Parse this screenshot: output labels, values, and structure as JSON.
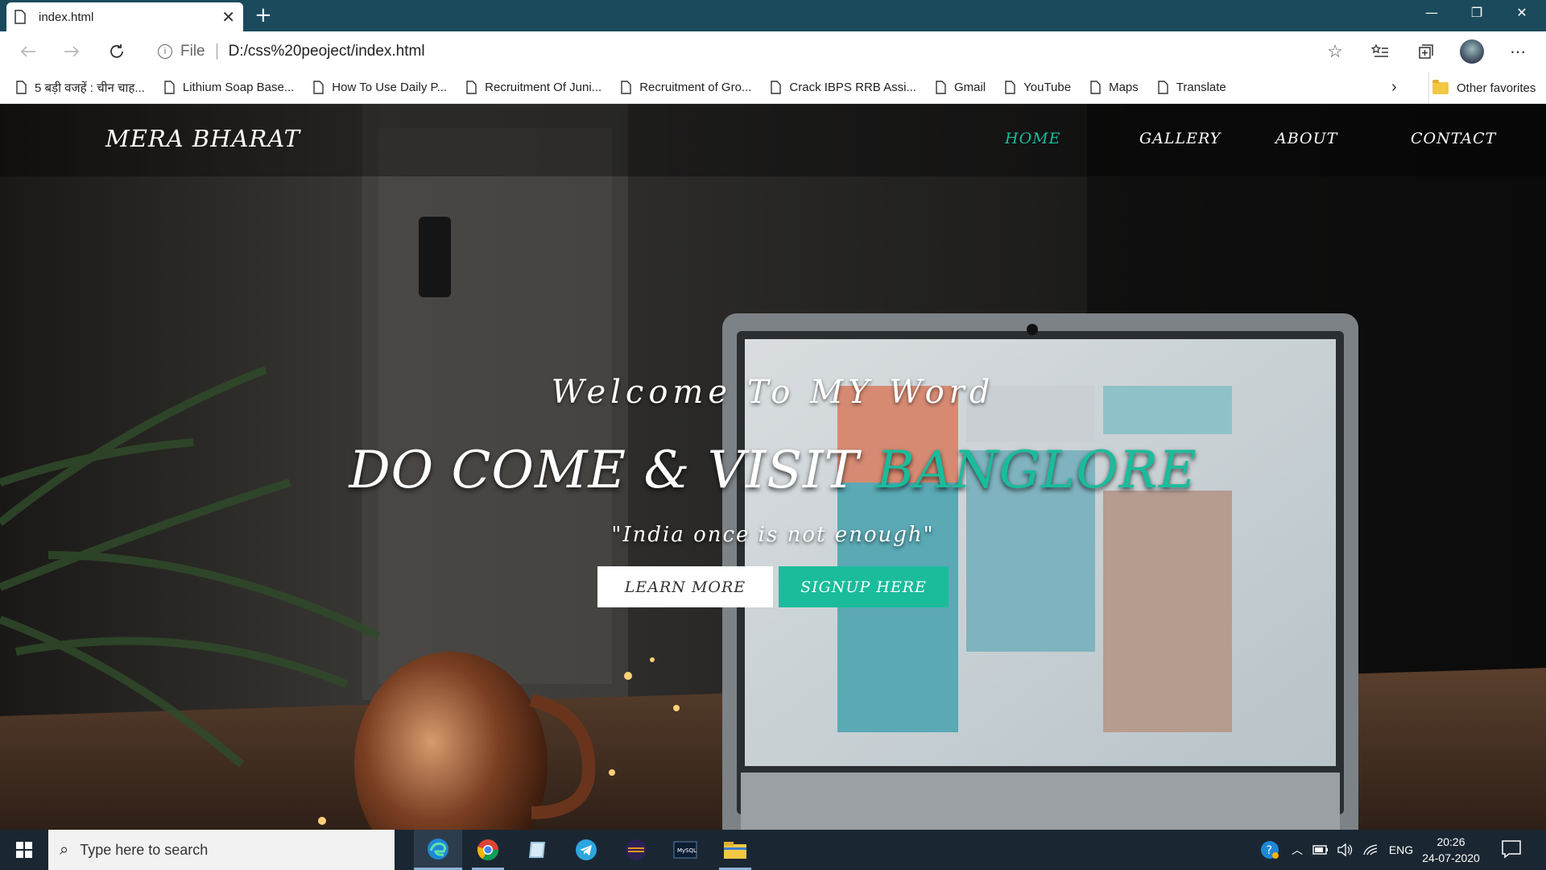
{
  "browser": {
    "tab_title": "index.html",
    "new_tab_symbol": "+",
    "close_symbol": "✕",
    "address": {
      "scheme": "File",
      "url": "D:/css%20peoject/index.html"
    },
    "window": {
      "minimize": "—",
      "restore": "❐",
      "close": "✕"
    }
  },
  "favorites": {
    "items": [
      "5 बड़ी वजहें : चीन चाह...",
      "Lithium Soap Base...",
      "How To Use Daily P...",
      "Recruitment Of Juni...",
      "Recruitment of Gro...",
      "Crack IBPS RRB Assi...",
      "Gmail",
      "YouTube",
      "Maps",
      "Translate"
    ],
    "more": "›",
    "other": "Other favorites"
  },
  "site": {
    "brand": "MERA BHARAT",
    "nav": [
      "HOME",
      "GALLERY",
      "ABOUT",
      "CONTACT"
    ],
    "nav_active": "HOME",
    "hero": {
      "subtitle": "Welcome To MY Word",
      "title_main": "DO COME & VISIT ",
      "title_accent": "BANGLORE",
      "quote": "\"India once is not enough\"",
      "btn_learn": "LEARN MORE",
      "btn_signup": "SIGNUP HERE"
    },
    "accent_color": "#1abc9c"
  },
  "taskbar": {
    "search_placeholder": "Type here to search",
    "tray": {
      "language": "ENG",
      "time": "20:26",
      "date": "24-07-2020"
    }
  }
}
